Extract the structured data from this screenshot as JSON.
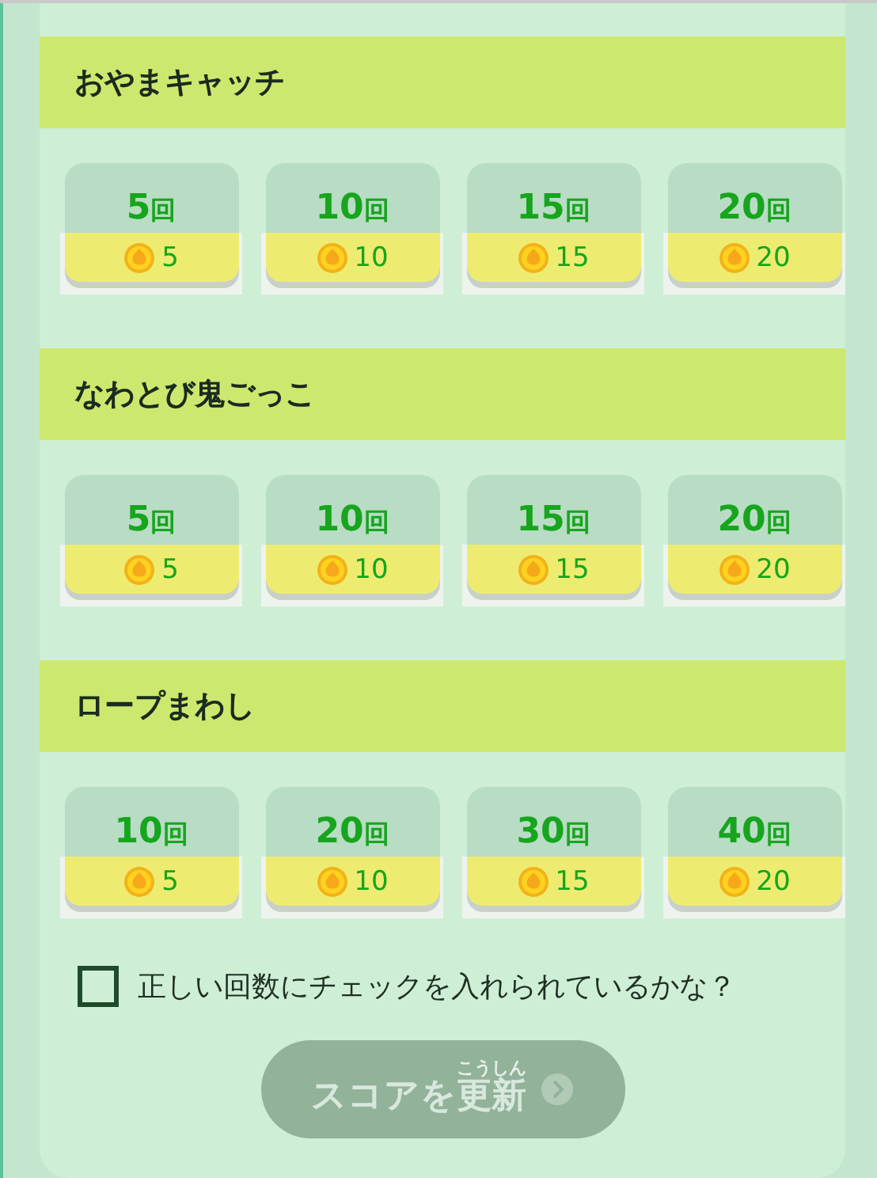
{
  "sections": [
    {
      "title": "おやまキャッチ",
      "options": [
        {
          "count": "5",
          "unit": "回",
          "coins": "5"
        },
        {
          "count": "10",
          "unit": "回",
          "coins": "10"
        },
        {
          "count": "15",
          "unit": "回",
          "coins": "15"
        },
        {
          "count": "20",
          "unit": "回",
          "coins": "20"
        }
      ]
    },
    {
      "title": "なわとび鬼ごっこ",
      "options": [
        {
          "count": "5",
          "unit": "回",
          "coins": "5"
        },
        {
          "count": "10",
          "unit": "回",
          "coins": "10"
        },
        {
          "count": "15",
          "unit": "回",
          "coins": "15"
        },
        {
          "count": "20",
          "unit": "回",
          "coins": "20"
        }
      ]
    },
    {
      "title": "ロープまわし",
      "options": [
        {
          "count": "10",
          "unit": "回",
          "coins": "5"
        },
        {
          "count": "20",
          "unit": "回",
          "coins": "10"
        },
        {
          "count": "30",
          "unit": "回",
          "coins": "15"
        },
        {
          "count": "40",
          "unit": "回",
          "coins": "20"
        }
      ]
    }
  ],
  "confirm": {
    "label": "正しい回数にチェックを入れられているかな？",
    "checked": false
  },
  "submit": {
    "text_before": "スコアを",
    "ruby_base": "更新",
    "ruby_text": "こうしん",
    "disabled": true
  }
}
